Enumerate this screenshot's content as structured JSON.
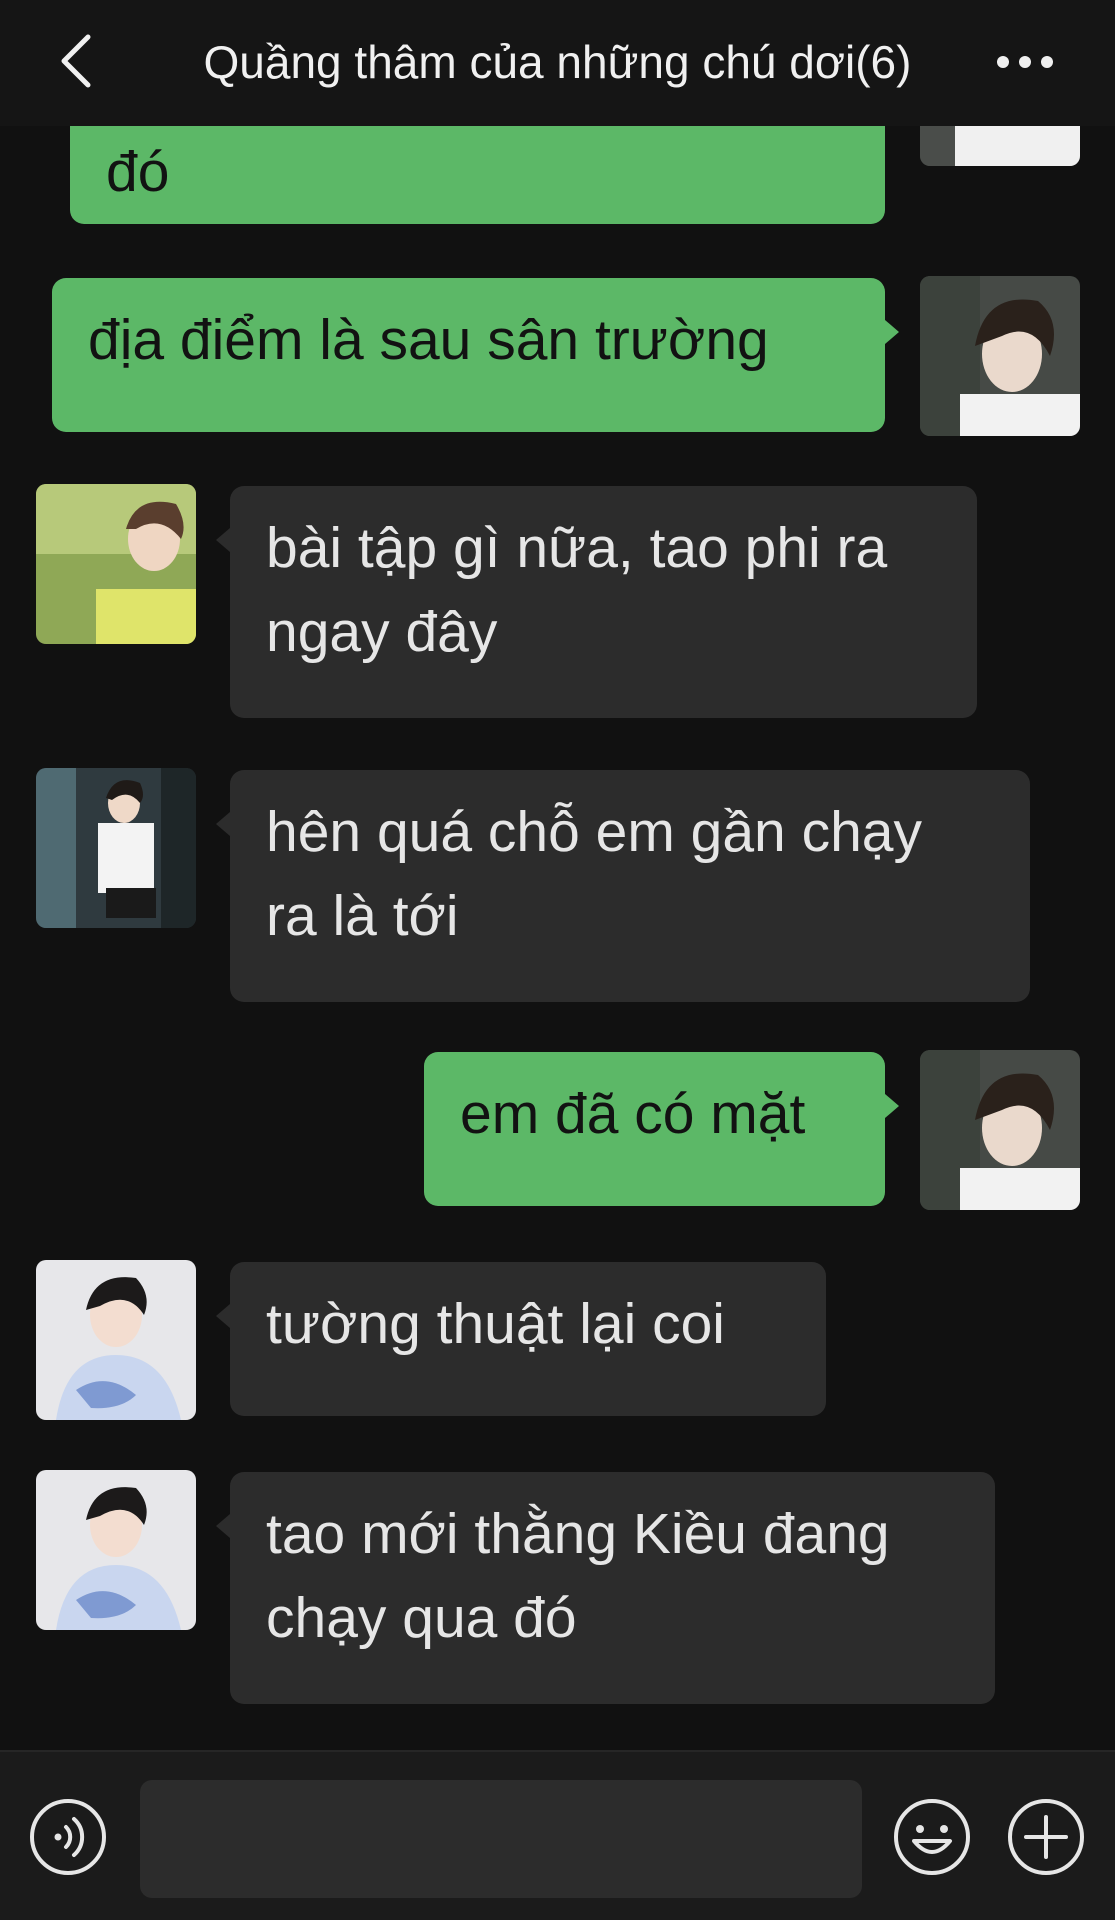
{
  "header": {
    "title": "Quầng thâm của những chú dơi(6)",
    "back_icon": "chevron-left-icon",
    "more_icon": "more-dots-icon"
  },
  "messages": [
    {
      "sender": "self",
      "avatar": "avatar-self",
      "lines": [
        "đó"
      ]
    },
    {
      "sender": "self",
      "avatar": "avatar-self",
      "lines": [
        "địa điểm là sau sân trường"
      ]
    },
    {
      "sender": "other",
      "avatar": "avatar-member-1",
      "lines": [
        "bài tập gì nữa, tao phi ra",
        "ngay đây"
      ]
    },
    {
      "sender": "other",
      "avatar": "avatar-member-2",
      "lines": [
        "hên quá chỗ em gần chạy",
        "ra là tới"
      ]
    },
    {
      "sender": "self",
      "avatar": "avatar-self",
      "lines": [
        "em đã có mặt"
      ]
    },
    {
      "sender": "other",
      "avatar": "avatar-member-3",
      "lines": [
        "tường thuật lại coi"
      ]
    },
    {
      "sender": "other",
      "avatar": "avatar-member-3",
      "lines": [
        "tao mới thằng Kiều đang",
        "chạy qua đó"
      ]
    }
  ],
  "input_bar": {
    "voice_icon": "voice-icon",
    "placeholder": "",
    "emoji_icon": "emoji-icon",
    "plus_icon": "plus-icon"
  },
  "colors": {
    "background": "#111111",
    "self_bubble": "#5cb867",
    "other_bubble": "#2c2c2c",
    "text_light": "#e6e6e6"
  }
}
